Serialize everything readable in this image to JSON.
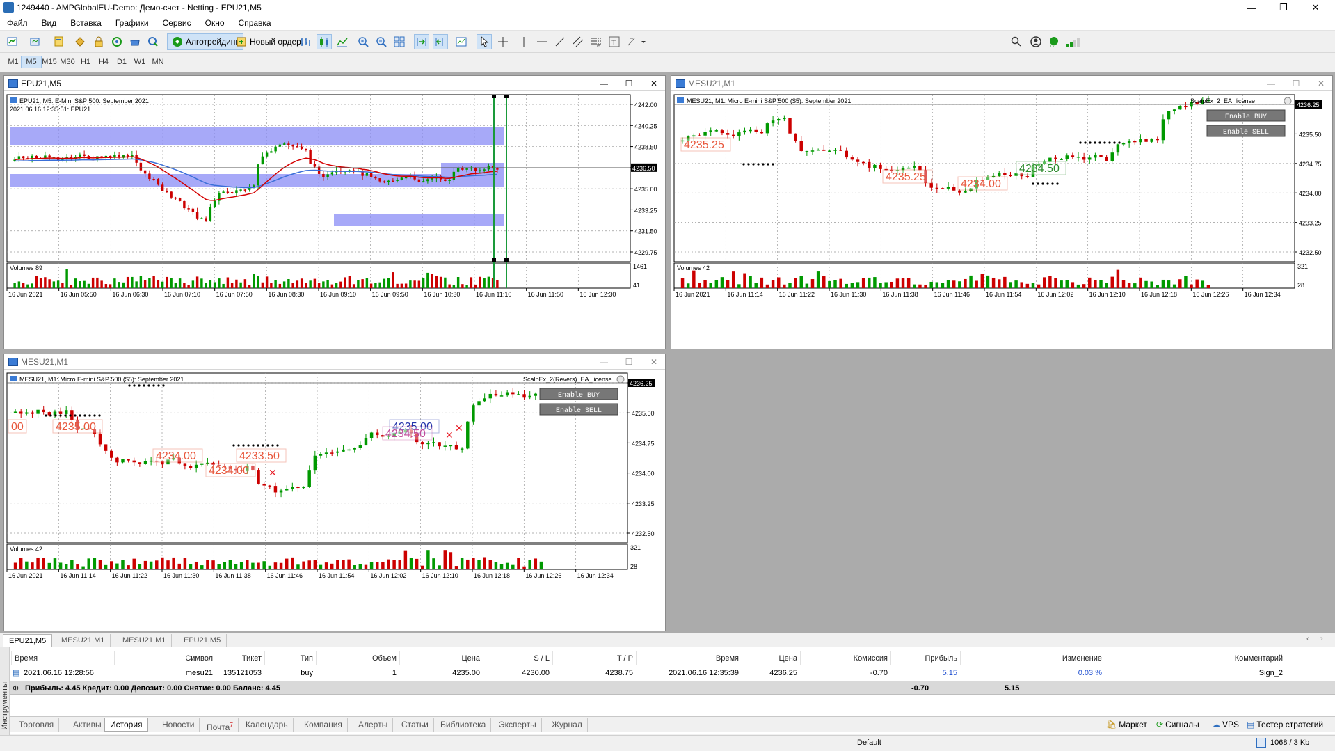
{
  "app": {
    "title": "1249440 - AMPGlobalEU-Demo: Демо-счет - Netting - EPU21,M5",
    "window_controls": [
      "—",
      "❐",
      "✕"
    ]
  },
  "menu": [
    "Файл",
    "Вид",
    "Вставка",
    "Графики",
    "Сервис",
    "Окно",
    "Справка"
  ],
  "toolbar": {
    "algotrading_label": "Алготрейдинг",
    "new_order_label": "Новый ордер"
  },
  "timeframes": {
    "items": [
      "M1",
      "M5",
      "M15",
      "M30",
      "H1",
      "H4",
      "D1",
      "W1",
      "MN"
    ],
    "active": "M5"
  },
  "charts": [
    {
      "title": "EPU21,M5",
      "header": "EPU21, M5:  E-Mini S&P 500: September 2021",
      "subheader": "2021.06.16 12:35:51: EPU21",
      "price_labels": [
        "4242.00",
        "4240.25",
        "4238.50",
        "4236.50",
        "4235.00",
        "4233.25",
        "4231.50",
        "4229.75"
      ],
      "current_price": "4236.50",
      "volumes_label": "Volumes 89",
      "vol_scale": [
        "1461",
        "41"
      ],
      "time_labels": [
        "16 Jun 2021",
        "16 Jun 05:50",
        "16 Jun 06:30",
        "16 Jun 07:10",
        "16 Jun 07:50",
        "16 Jun 08:30",
        "16 Jun 09:10",
        "16 Jun 09:50",
        "16 Jun 10:30",
        "16 Jun 11:10",
        "16 Jun 11:50",
        "16 Jun 12:30"
      ]
    },
    {
      "title": "MESU21,M1",
      "header": "MESU21, M1:  Micro E-mini S&P 500 ($5): September 2021",
      "ea_label": "ScalpEx_2_EA_license",
      "buy_label": "Enable BUY",
      "sell_label": "Enable SELL",
      "price_labels": [
        "4236.25",
        "4235.50",
        "4234.75",
        "4234.00",
        "4233.25",
        "4232.50"
      ],
      "current_price": "4236.25",
      "volumes_label": "Volumes 42",
      "vol_scale": [
        "321",
        "28"
      ],
      "annotations": [
        "4235.25",
        "4235.25",
        "4234.00",
        "4234.50"
      ],
      "time_labels": [
        "16 Jun 2021",
        "16 Jun 11:14",
        "16 Jun 11:22",
        "16 Jun 11:30",
        "16 Jun 11:38",
        "16 Jun 11:46",
        "16 Jun 11:54",
        "16 Jun 12:02",
        "16 Jun 12:10",
        "16 Jun 12:18",
        "16 Jun 12:26",
        "16 Jun 12:34"
      ]
    },
    {
      "title": "MESU21,M1",
      "header": "MESU21, M1:  Micro E-mini S&P 500 ($5): September 2021",
      "ea_label": "ScalpEx_2(Revers)_EA_license",
      "buy_label": "Enable BUY",
      "sell_label": "Enable SELL",
      "price_labels": [
        "4236.25",
        "4235.50",
        "4234.75",
        "4234.00",
        "4233.25",
        "4232.50"
      ],
      "current_price": "4236.25",
      "volumes_label": "Volumes 42",
      "vol_scale": [
        "321",
        "28"
      ],
      "annotations": [
        "00",
        "4235.00",
        "4234.00",
        "4234.00",
        "4233.50",
        "4235.00",
        "4234.50"
      ],
      "time_labels": [
        "16 Jun 2021",
        "16 Jun 11:14",
        "16 Jun 11:22",
        "16 Jun 11:30",
        "16 Jun 11:38",
        "16 Jun 11:46",
        "16 Jun 11:54",
        "16 Jun 12:02",
        "16 Jun 12:10",
        "16 Jun 12:18",
        "16 Jun 12:26",
        "16 Jun 12:34"
      ]
    }
  ],
  "chart_tabs": [
    "EPU21,M5",
    "MESU21,M1",
    "MESU21,M1",
    "EPU21,M5"
  ],
  "terminal": {
    "side_label": "Инструменты",
    "columns": [
      "Время",
      "Символ",
      "Тикет",
      "Тип",
      "Объем",
      "Цена",
      "S / L",
      "T / P",
      "Время",
      "Цена",
      "Комиссия",
      "Прибыль",
      "Изменение",
      "Комментарий"
    ],
    "row": [
      "2021.06.16 12:28:56",
      "mesu21",
      "135121053",
      "buy",
      "1",
      "4235.00",
      "4230.00",
      "4238.75",
      "2021.06.16 12:35:39",
      "4236.25",
      "-0.70",
      "5.15",
      "0.03 %",
      "Sign_2"
    ],
    "summary": "Прибыль: 4.45  Кредит: 0.00  Депозит: 0.00  Снятие: 0.00  Баланс: 4.45",
    "summary_commission": "-0.70",
    "summary_profit": "5.15",
    "tabs": [
      "Торговля",
      "Активы",
      "История",
      "Новости",
      "Почта",
      "Календарь",
      "Компания",
      "Алерты",
      "Статьи",
      "Библиотека",
      "Эксперты",
      "Журнал"
    ],
    "active_tab": "История",
    "mail_badge": "7",
    "right_links": [
      "Маркет",
      "Сигналы",
      "VPS",
      "Тестер стратегий"
    ]
  },
  "status": {
    "profile": "Default",
    "traffic": "1068 / 3 Kb"
  },
  "colors": {
    "bull": "#009900",
    "bear": "#cc0000",
    "zone": "#8a8cf5",
    "ma_red": "#d40000",
    "ma_blue": "#3a6fd8",
    "annotation": "#e8573c"
  }
}
